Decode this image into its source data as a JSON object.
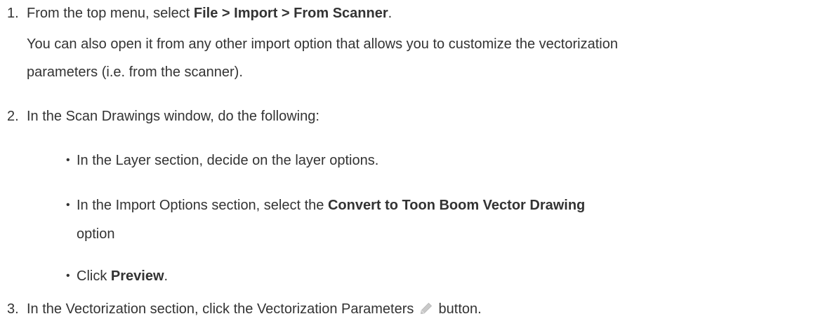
{
  "steps": [
    {
      "number": "1.",
      "pre": "From the top menu, select ",
      "bold": "File > Import > From Scanner",
      "post": ".",
      "note_line1": "You can also open it from any other import option that allows you to customize the vectorization",
      "note_line2": "parameters (i.e. from the scanner)."
    },
    {
      "number": "2.",
      "text": "In the Scan Drawings window, do the following:",
      "bullets": [
        {
          "text": "In the Layer section, decide on the layer options."
        },
        {
          "pre": "In the Import Options section, select the ",
          "bold": "Convert to Toon Boom Vector Drawing",
          "line2": "option"
        },
        {
          "pre": "Click ",
          "bold": "Preview",
          "post": "."
        }
      ]
    },
    {
      "number": "3.",
      "pre": "In the Vectorization section, click the Vectorization Parameters",
      "icon": "pencil-icon",
      "post": "button."
    }
  ],
  "colors": {
    "text": "#333333",
    "icon": "#c9c9c9"
  }
}
